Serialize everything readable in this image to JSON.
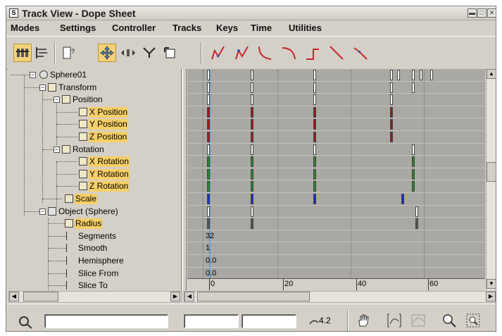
{
  "window": {
    "title": "Track View - Dope Sheet",
    "app_icon": "3ds-max-icon",
    "controls": [
      "minimize",
      "maximize",
      "close"
    ]
  },
  "menubar": {
    "items": [
      "Modes",
      "Settings",
      "Controller",
      "Tracks",
      "Keys",
      "Time",
      "Utilities"
    ]
  },
  "toolbar": {
    "buttons": [
      {
        "name": "edit-keys-icon",
        "active": true
      },
      {
        "name": "edit-ranges-icon",
        "active": false
      },
      {
        "name": "filters-icon",
        "active": false
      },
      {
        "name": "move-keys-icon",
        "active": true
      },
      {
        "name": "slide-keys-icon",
        "active": false
      },
      {
        "name": "scale-keys-icon",
        "active": false
      },
      {
        "name": "scale-time-icon",
        "active": false
      },
      {
        "name": "tangent-auto-icon",
        "active": false
      },
      {
        "name": "tangent-custom-icon",
        "active": false
      },
      {
        "name": "tangent-fast-icon",
        "active": false
      },
      {
        "name": "tangent-slow-icon",
        "active": false
      },
      {
        "name": "tangent-step-icon",
        "active": false
      },
      {
        "name": "tangent-linear-icon",
        "active": false
      },
      {
        "name": "tangent-smooth-icon",
        "active": false
      }
    ]
  },
  "tree": {
    "nodes": [
      {
        "label": "Sphere01",
        "level": 0,
        "highlight": false,
        "icon": "sphere-icon"
      },
      {
        "label": "Transform",
        "level": 1,
        "highlight": false,
        "icon": "transform-icon"
      },
      {
        "label": "Position",
        "level": 2,
        "highlight": false,
        "icon": "position-icon"
      },
      {
        "label": "X Position",
        "level": 3,
        "highlight": true,
        "icon": "float-controller-icon"
      },
      {
        "label": "Y Position",
        "level": 3,
        "highlight": true,
        "icon": "float-controller-icon"
      },
      {
        "label": "Z Position",
        "level": 3,
        "highlight": true,
        "icon": "float-controller-icon"
      },
      {
        "label": "Rotation",
        "level": 2,
        "highlight": false,
        "icon": "rotation-icon"
      },
      {
        "label": "X Rotation",
        "level": 3,
        "highlight": true,
        "icon": "float-controller-icon"
      },
      {
        "label": "Y Rotation",
        "level": 3,
        "highlight": true,
        "icon": "float-controller-icon"
      },
      {
        "label": "Z Rotation",
        "level": 3,
        "highlight": true,
        "icon": "float-controller-icon"
      },
      {
        "label": "Scale",
        "level": 2,
        "highlight": true,
        "icon": "scale-icon"
      },
      {
        "label": "Object (Sphere)",
        "level": 1,
        "highlight": false,
        "icon": "object-icon"
      },
      {
        "label": "Radius",
        "level": 2,
        "highlight": true,
        "icon": "float-controller-icon"
      },
      {
        "label": "Segments",
        "level": 2,
        "highlight": false,
        "icon": "param-icon"
      },
      {
        "label": "Smooth",
        "level": 2,
        "highlight": false,
        "icon": "param-icon"
      },
      {
        "label": "Hemisphere",
        "level": 2,
        "highlight": false,
        "icon": "param-icon"
      },
      {
        "label": "Slice From",
        "level": 2,
        "highlight": false,
        "icon": "param-icon"
      },
      {
        "label": "Slice To",
        "level": 2,
        "highlight": false,
        "icon": "param-icon"
      }
    ]
  },
  "dope_sheet": {
    "rows": [
      {
        "values": [],
        "keys": [
          {
            "frame": 0,
            "color": "#ffffff"
          },
          {
            "frame": 12,
            "color": "#ffffff"
          },
          {
            "frame": 29,
            "color": "#ffffff"
          },
          {
            "frame": 50,
            "color": "#ffffff"
          },
          {
            "frame": 52,
            "color": "#ffffff"
          },
          {
            "frame": 56,
            "color": "#ffffff"
          },
          {
            "frame": 58,
            "color": "#ffffff"
          },
          {
            "frame": 61,
            "color": "#ffffff"
          }
        ]
      },
      {
        "keys": [
          {
            "frame": 0,
            "color": "#ffffff"
          },
          {
            "frame": 12,
            "color": "#ffffff"
          },
          {
            "frame": 29,
            "color": "#ffffff"
          },
          {
            "frame": 50,
            "color": "#ffffff"
          },
          {
            "frame": 56,
            "color": "#ffffff"
          }
        ]
      },
      {
        "keys": [
          {
            "frame": 0,
            "color": "#ffffff"
          },
          {
            "frame": 12,
            "color": "#ffffff"
          },
          {
            "frame": 29,
            "color": "#ffffff"
          },
          {
            "frame": 50,
            "color": "#ffffff"
          }
        ]
      },
      {
        "keys": [
          {
            "frame": 0,
            "color": "#a01818"
          },
          {
            "frame": 12,
            "color": "#a01818"
          },
          {
            "frame": 29,
            "color": "#a01818"
          },
          {
            "frame": 50,
            "color": "#a01818"
          }
        ]
      },
      {
        "keys": [
          {
            "frame": 0,
            "color": "#a01818"
          },
          {
            "frame": 12,
            "color": "#a01818"
          },
          {
            "frame": 29,
            "color": "#a01818"
          },
          {
            "frame": 50,
            "color": "#a01818"
          }
        ]
      },
      {
        "keys": [
          {
            "frame": 0,
            "color": "#a01818"
          },
          {
            "frame": 12,
            "color": "#a01818"
          },
          {
            "frame": 29,
            "color": "#a01818"
          },
          {
            "frame": 50,
            "color": "#a01818"
          }
        ]
      },
      {
        "keys": [
          {
            "frame": 0,
            "color": "#ffffff"
          },
          {
            "frame": 12,
            "color": "#ffffff"
          },
          {
            "frame": 29,
            "color": "#ffffff"
          },
          {
            "frame": 56,
            "color": "#ffffff"
          }
        ]
      },
      {
        "keys": [
          {
            "frame": 0,
            "color": "#1e8a2a"
          },
          {
            "frame": 12,
            "color": "#1e8a2a"
          },
          {
            "frame": 29,
            "color": "#1e8a2a"
          },
          {
            "frame": 56,
            "color": "#1e8a2a"
          }
        ]
      },
      {
        "keys": [
          {
            "frame": 0,
            "color": "#1e8a2a"
          },
          {
            "frame": 12,
            "color": "#1e8a2a"
          },
          {
            "frame": 29,
            "color": "#1e8a2a"
          },
          {
            "frame": 56,
            "color": "#1e8a2a"
          }
        ]
      },
      {
        "keys": [
          {
            "frame": 0,
            "color": "#1e8a2a"
          },
          {
            "frame": 12,
            "color": "#1e8a2a"
          },
          {
            "frame": 29,
            "color": "#1e8a2a"
          },
          {
            "frame": 56,
            "color": "#1e8a2a"
          }
        ]
      },
      {
        "keys": [
          {
            "frame": 0,
            "color": "#1a2cc8"
          },
          {
            "frame": 12,
            "color": "#1a2cc8"
          },
          {
            "frame": 29,
            "color": "#1a2cc8"
          },
          {
            "frame": 53,
            "color": "#1a2cc8"
          }
        ]
      },
      {
        "keys": [
          {
            "frame": 0,
            "color": "#ffffff"
          },
          {
            "frame": 12,
            "color": "#ffffff"
          },
          {
            "frame": 57,
            "color": "#ffffff"
          }
        ]
      },
      {
        "keys": [
          {
            "frame": 0,
            "color": "#555555"
          },
          {
            "frame": 12,
            "color": "#555555"
          },
          {
            "frame": 57,
            "color": "#555555"
          }
        ]
      },
      {
        "value": "32"
      },
      {
        "value": "1"
      },
      {
        "value": "0.0"
      },
      {
        "value": "0.0"
      }
    ],
    "time_ruler": {
      "labels": [
        "0",
        "20",
        "40",
        "60"
      ]
    }
  },
  "statusbar": {
    "zoom_value": "4.2",
    "icons": [
      "key-filter-icon",
      "pan-hand-icon",
      "zoom-horizontal-extents-icon",
      "zoom-value-extents-icon",
      "zoom-icon",
      "zoom-region-icon"
    ]
  },
  "colors": {
    "highlight": "#f6cf66",
    "position_keys": "#a01818",
    "rotation_keys": "#1e8a2a",
    "scale_keys": "#1a2cc8",
    "time_marker": "#2d7dbf"
  }
}
